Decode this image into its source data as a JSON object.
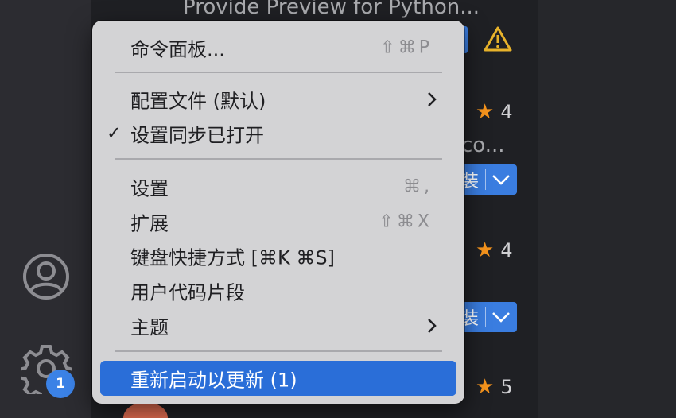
{
  "activity_bar": {
    "badge_count": "1"
  },
  "extensions": {
    "title": "Provide Preview for Python...",
    "fragment_co": "co...",
    "install_fragment": "装",
    "ratings": [
      "4",
      "4",
      "5"
    ],
    "star": "★",
    "bottom_text": "..."
  },
  "menu": {
    "items": [
      {
        "label": "命令面板...",
        "shortcut": "⇧⌘P"
      },
      {
        "label": "配置文件 (默认)"
      },
      {
        "label": "设置同步已打开",
        "check": "✓"
      },
      {
        "label": "设置",
        "shortcut": "⌘,"
      },
      {
        "label": "扩展",
        "shortcut": "⇧⌘X"
      },
      {
        "label": "键盘快捷方式 [⌘K ⌘S]"
      },
      {
        "label": "用户代码片段"
      },
      {
        "label": "主题"
      },
      {
        "label": "重新启动以更新 (1)"
      }
    ]
  },
  "colors": {
    "accent": "#2a6ed8",
    "badge": "#3b82e6",
    "star": "#f6941d",
    "warning": "#e8b32b"
  }
}
